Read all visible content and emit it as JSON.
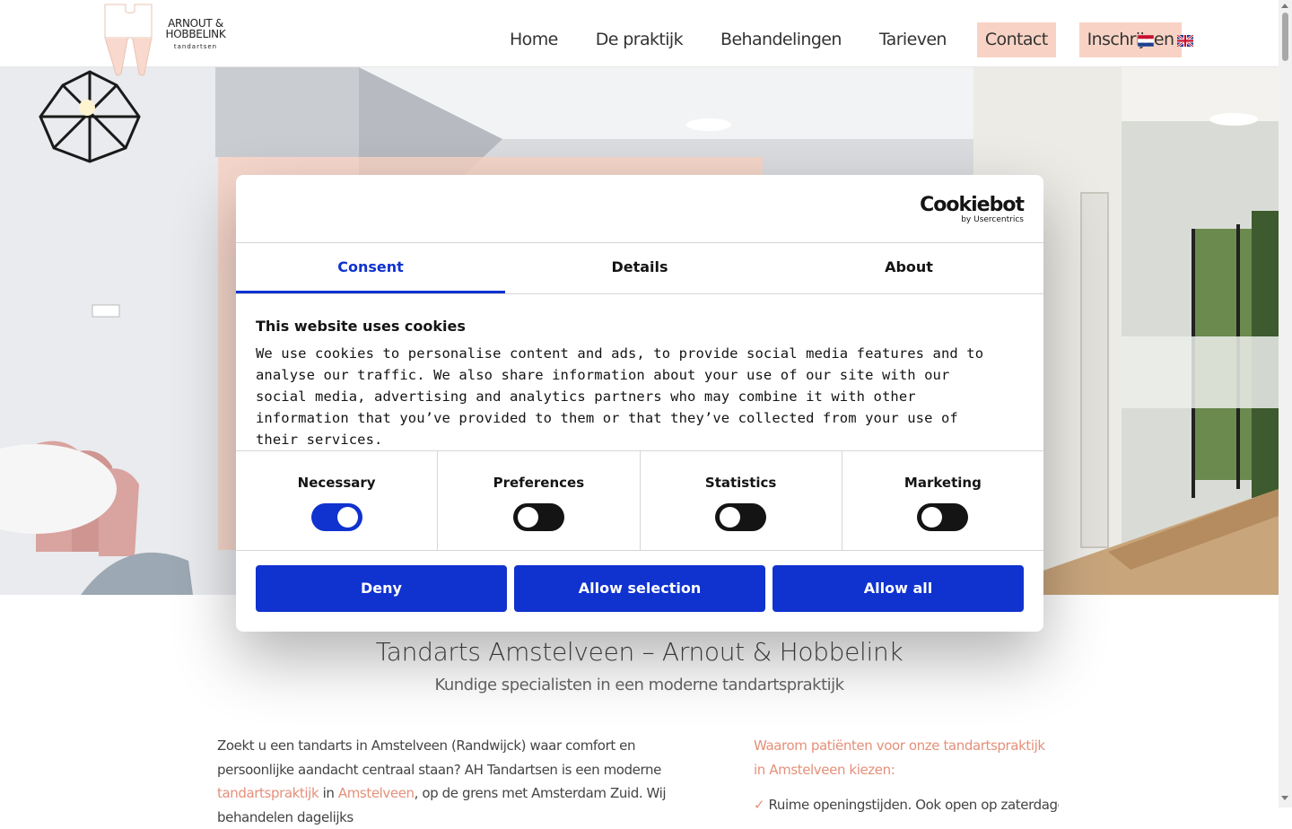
{
  "logo": {
    "line1": "ARNOUT &",
    "line2": "HOBBELINK",
    "sub": "tandartsen"
  },
  "nav": {
    "home": "Home",
    "praktijk": "De praktijk",
    "behandelingen": "Behandelingen",
    "tarieven": "Tarieven",
    "contact": "Contact",
    "inschrijven": "Inschrijven"
  },
  "colors": {
    "accent": "#f8d3c5",
    "link": "#e4907a",
    "cookiebot_blue": "#1032cf"
  },
  "cookie_dialog": {
    "brand": "Cookiebot",
    "brand_sub": "by Usercentrics",
    "tabs": [
      "Consent",
      "Details",
      "About"
    ],
    "title": "This website uses cookies",
    "text": "We use cookies to personalise content and ads, to provide social media features and to analyse our traffic. We also share information about your use of our site with our social media, advertising and analytics partners who may combine it with other information that you’ve provided to them or that they’ve collected from your use of their services.",
    "categories": [
      {
        "label": "Necessary",
        "on": true
      },
      {
        "label": "Preferences",
        "on": false
      },
      {
        "label": "Statistics",
        "on": false
      },
      {
        "label": "Marketing",
        "on": false
      }
    ],
    "buttons": {
      "deny": "Deny",
      "allow_selection": "Allow selection",
      "allow_all": "Allow all"
    }
  },
  "page": {
    "title": "Tandarts Amstelveen – Arnout & Hobbelink",
    "subtitle": "Kundige specialisten in een moderne tandartspraktijk",
    "intro_1": "Zoekt u een tandarts in Amstelveen (Randwijck) waar comfort en persoonlijke aandacht centraal staan? AH Tandartsen is een moderne ",
    "intro_link_1": "tandartspraktijk",
    "intro_2": " in ",
    "intro_link_2": "Amstelveen",
    "intro_3": ", op de grens met Amsterdam Zuid. Wij behandelen dagelijks",
    "why_title": "Waarom patiënten voor onze tandartspraktijk in Amstelveen kiezen:",
    "why_item": "Ruime openingstijden. Ook open op zaterdagen"
  }
}
